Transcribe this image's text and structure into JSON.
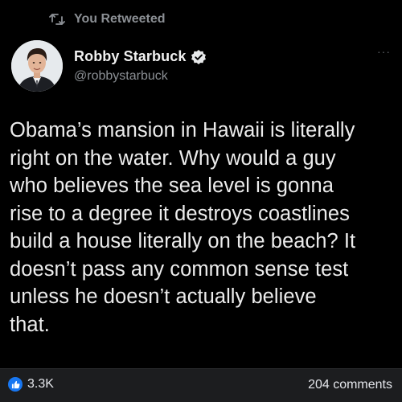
{
  "retweet_banner": {
    "label": "You Retweeted",
    "icon": "retweet-icon"
  },
  "author": {
    "name": "Robby Starbuck",
    "handle": "@robbystarbuck",
    "verified": true,
    "verified_color": "#1d9bf0"
  },
  "more_menu": {
    "label": "···"
  },
  "tweet": {
    "text": "Obama’s mansion in Hawaii is literally\nright on the water. Why would a guy\nwho believes the sea level is gonna\nrise to a degree it destroys coastlines\nbuild a house literally on the beach? It\ndoesn’t pass any common sense test\nunless he doesn’t actually believe\nthat."
  },
  "footer": {
    "likes": "3.3K",
    "like_icon": "thumbs-up-icon",
    "like_color": "#1877f2",
    "comments": "204 comments"
  }
}
